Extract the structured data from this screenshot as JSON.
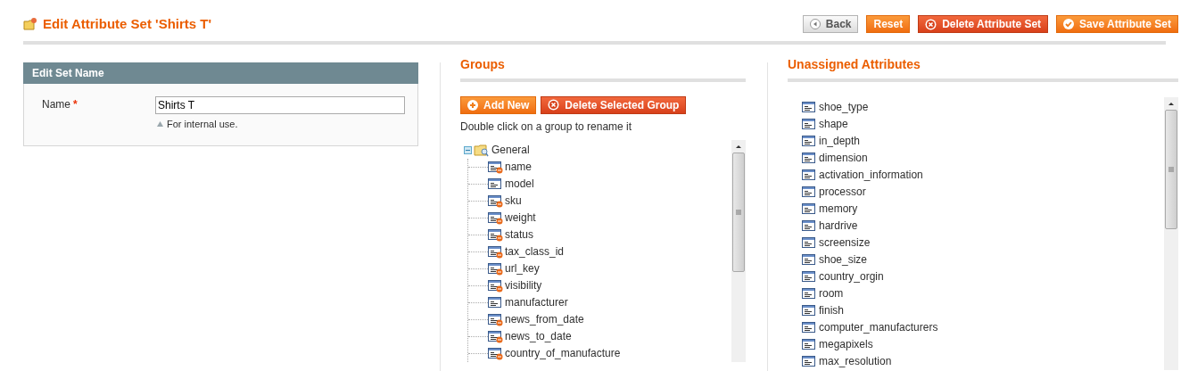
{
  "header": {
    "title": "Edit Attribute Set 'Shirts T'",
    "buttons": [
      {
        "kind": "back",
        "label": "Back"
      },
      {
        "kind": "plain",
        "label": "Reset"
      },
      {
        "kind": "delete",
        "label": "Delete Attribute Set"
      },
      {
        "kind": "save",
        "label": "Save Attribute Set"
      }
    ]
  },
  "edit_set_name": {
    "title": "Edit Set Name",
    "label": "Name",
    "required_mark": "*",
    "value": "Shirts T",
    "note": "For internal use."
  },
  "groups": {
    "title": "Groups",
    "buttons": [
      {
        "kind": "add",
        "label": "Add New"
      },
      {
        "kind": "delete",
        "label": "Delete Selected Group"
      }
    ],
    "hint": "Double click on a group to rename it",
    "tree": [
      {
        "label": "General",
        "expanded": true,
        "children": [
          {
            "label": "name",
            "kind": "system"
          },
          {
            "label": "model",
            "kind": "user"
          },
          {
            "label": "sku",
            "kind": "system"
          },
          {
            "label": "weight",
            "kind": "system"
          },
          {
            "label": "status",
            "kind": "system"
          },
          {
            "label": "tax_class_id",
            "kind": "system"
          },
          {
            "label": "url_key",
            "kind": "system"
          },
          {
            "label": "visibility",
            "kind": "system"
          },
          {
            "label": "manufacturer",
            "kind": "user"
          },
          {
            "label": "news_from_date",
            "kind": "system"
          },
          {
            "label": "news_to_date",
            "kind": "system"
          },
          {
            "label": "country_of_manufacture",
            "kind": "system"
          }
        ]
      }
    ]
  },
  "unassigned": {
    "title": "Unassigned Attributes",
    "items": [
      {
        "label": "shoe_type",
        "kind": "user"
      },
      {
        "label": "shape",
        "kind": "user"
      },
      {
        "label": "in_depth",
        "kind": "user"
      },
      {
        "label": "dimension",
        "kind": "user"
      },
      {
        "label": "activation_information",
        "kind": "user"
      },
      {
        "label": "processor",
        "kind": "user"
      },
      {
        "label": "memory",
        "kind": "user"
      },
      {
        "label": "hardrive",
        "kind": "user"
      },
      {
        "label": "screensize",
        "kind": "user"
      },
      {
        "label": "shoe_size",
        "kind": "user"
      },
      {
        "label": "country_orgin",
        "kind": "user"
      },
      {
        "label": "room",
        "kind": "user"
      },
      {
        "label": "finish",
        "kind": "user"
      },
      {
        "label": "computer_manufacturers",
        "kind": "user"
      },
      {
        "label": "megapixels",
        "kind": "user"
      },
      {
        "label": "max_resolution",
        "kind": "user"
      }
    ]
  }
}
